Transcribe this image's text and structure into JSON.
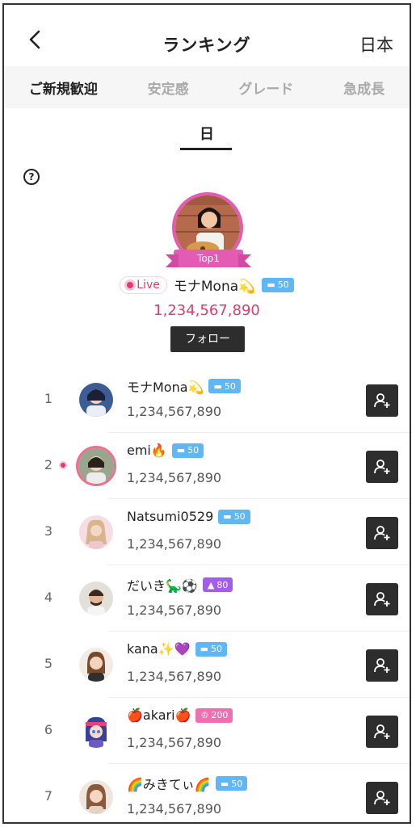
{
  "header": {
    "title": "ランキング",
    "region": "日本"
  },
  "tabs": [
    {
      "label": "ご新規歓迎",
      "active": true
    },
    {
      "label": "安定感",
      "active": false
    },
    {
      "label": "グレード",
      "active": false
    },
    {
      "label": "急成長",
      "active": false
    }
  ],
  "period": "日",
  "top1": {
    "ribbon": "Top1",
    "live_label": "Live",
    "name": "モナMona💫",
    "level": "50",
    "score": "1,234,567,890",
    "follow_label": "フォロー"
  },
  "rows": [
    {
      "rank": "1",
      "name": "モナMona💫",
      "level": "50",
      "score": "1,234,567,890",
      "badge_color": "#5fb7f5",
      "live": false
    },
    {
      "rank": "2",
      "name": "emi🔥",
      "level": "50",
      "score": "1,234,567,890",
      "badge_color": "#5fb7f5",
      "live": true
    },
    {
      "rank": "3",
      "name": "Natsumi0529",
      "level": "50",
      "score": "1,234,567,890",
      "badge_color": "#5fb7f5",
      "live": false
    },
    {
      "rank": "4",
      "name": "だいき🦕⚽",
      "level": "80",
      "score": "1,234,567,890",
      "badge_color": "#a35bf0",
      "live": false
    },
    {
      "rank": "5",
      "name": "kana✨💜",
      "level": "50",
      "score": "1,234,567,890",
      "badge_color": "#5fb7f5",
      "live": false
    },
    {
      "rank": "6",
      "name": "🍎akari🍎",
      "level": "200",
      "score": "1,234,567,890",
      "badge_color": "#ef6fb2",
      "live": false
    },
    {
      "rank": "7",
      "name": "🌈みきてぃ🌈",
      "level": "50",
      "score": "1,234,567,890",
      "badge_color": "#5fb7f5",
      "live": false
    }
  ],
  "colors": {
    "accent": "#e23b6c",
    "top_ring": "#e45bb4",
    "dark_button": "#2d2d2d"
  }
}
